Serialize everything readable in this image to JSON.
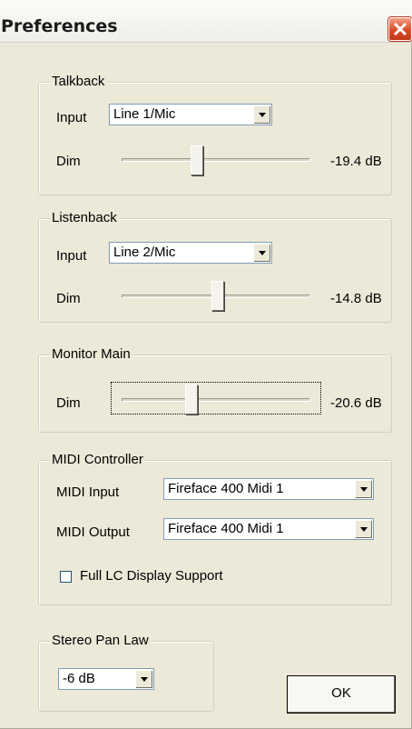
{
  "window": {
    "title": "Preferences",
    "close_icon": "close-x-icon"
  },
  "talkback": {
    "label": "Talkback",
    "input_label": "Input",
    "input_value": "Line 1/Mic",
    "dim_label": "Dim",
    "dim_value": "-19.4 dB",
    "dim_slider_position": 0.39
  },
  "listenback": {
    "label": "Listenback",
    "input_label": "Input",
    "input_value": "Line 2/Mic",
    "dim_label": "Dim",
    "dim_value": "-14.8 dB",
    "dim_slider_position": 0.51
  },
  "monitor_main": {
    "label": "Monitor Main",
    "dim_label": "Dim",
    "dim_value": "-20.6 dB",
    "dim_slider_position": 0.36
  },
  "midi_controller": {
    "label": "MIDI Controller",
    "midi_input_label": "MIDI Input",
    "midi_input_value": "Fireface 400 Midi 1",
    "midi_output_label": "MIDI Output",
    "midi_output_value": "Fireface 400 Midi 1",
    "full_lc_label": "Full LC Display Support",
    "full_lc_checked": false
  },
  "stereo_pan_law": {
    "label": "Stereo Pan Law",
    "value": "-6 dB"
  },
  "ok_label": "OK",
  "colors": {
    "dialog_bg": "#ece9d8",
    "close_button": "#d94a24",
    "group_border": "#d0d0bf"
  }
}
